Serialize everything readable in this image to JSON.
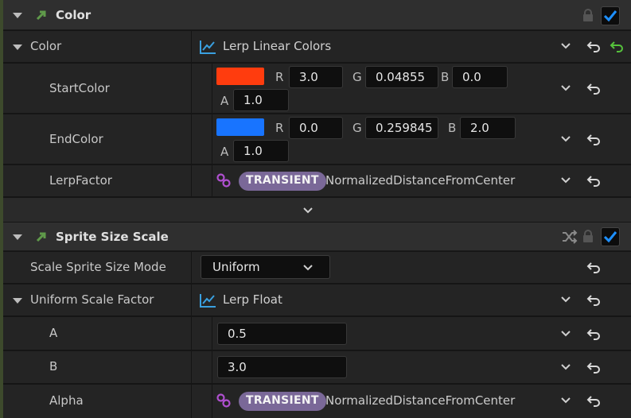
{
  "colors": {
    "accent": "#1e90ff",
    "curve_icon": "#3aa0e0",
    "link_icon": "#b050d0",
    "transient_chip": "#7a6898",
    "module_icon": "#5f9a4a",
    "start_swatch": "#ff3c0e",
    "end_swatch": "#1874ff",
    "reset_green": "#56c23c"
  },
  "color_module": {
    "title": "Color",
    "enabled": true,
    "icons": [
      "module-arrow-icon",
      "lock-icon",
      "checkbox-icon"
    ]
  },
  "color_prop": {
    "label": "Color",
    "value": "Lerp Linear Colors",
    "icon": "curve-icon"
  },
  "start_color": {
    "label": "StartColor",
    "r_label": "R",
    "r": "3.0",
    "g_label": "G",
    "g": "0.04855",
    "b_label": "B",
    "b": "0.0",
    "a_label": "A",
    "a": "1.0"
  },
  "end_color": {
    "label": "EndColor",
    "r_label": "R",
    "r": "0.0",
    "g_label": "G",
    "g": "0.259845",
    "b_label": "B",
    "b": "2.0",
    "a_label": "A",
    "a": "1.0"
  },
  "lerp_factor": {
    "label": "LerpFactor",
    "chip": "TRANSIENT",
    "value": "NormalizedDistanceFromCenter",
    "icon": "link-icon"
  },
  "sprite_module": {
    "title": "Sprite Size Scale",
    "enabled": true,
    "icons": [
      "module-arrow-icon",
      "shuffle-icon",
      "lock-icon",
      "checkbox-icon"
    ]
  },
  "scale_mode": {
    "label": "Scale Sprite Size Mode",
    "selected": "Uniform"
  },
  "uniform_scale": {
    "label": "Uniform Scale Factor",
    "value": "Lerp Float",
    "icon": "curve-icon"
  },
  "a_prop": {
    "label": "A",
    "value": "0.5"
  },
  "b_prop": {
    "label": "B",
    "value": "3.0"
  },
  "alpha_prop": {
    "label": "Alpha",
    "chip": "TRANSIENT",
    "value": "NormalizedDistanceFromCenter",
    "icon": "link-icon"
  }
}
